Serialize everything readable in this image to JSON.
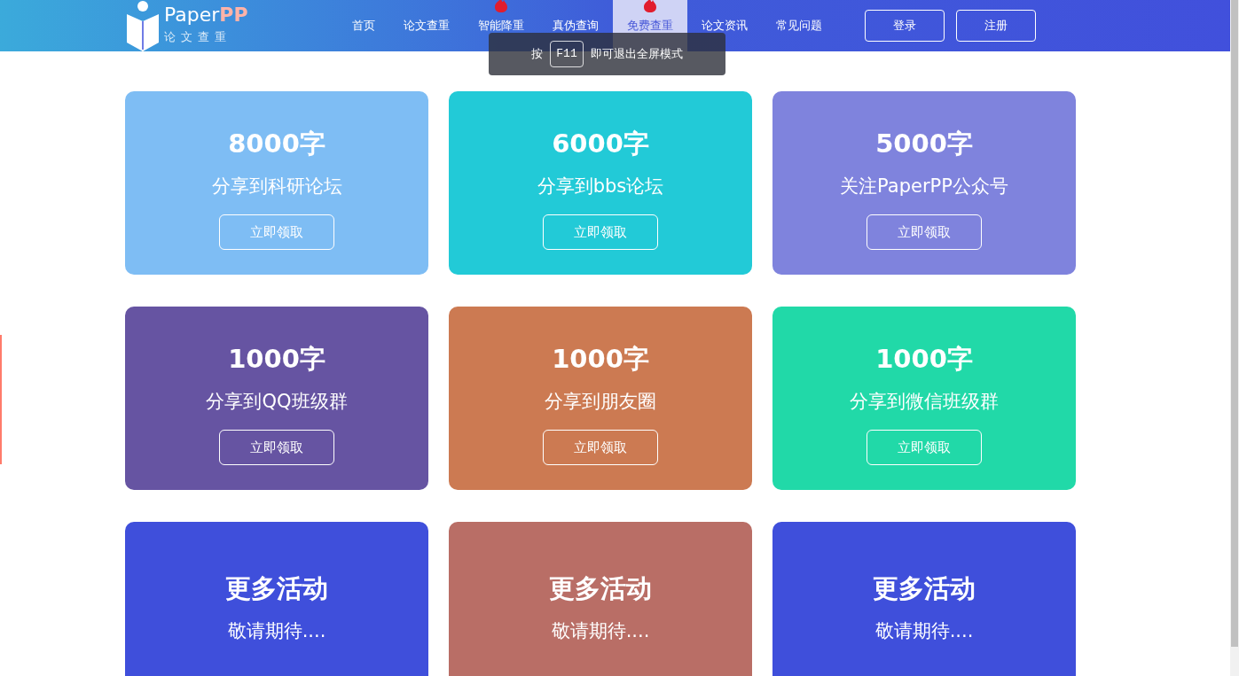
{
  "logo": {
    "name_part1": "Paper",
    "name_part2": "PP",
    "subtitle": "论文查重"
  },
  "nav": [
    {
      "label": "首页",
      "selected": false,
      "hot": false
    },
    {
      "label": "论文查重",
      "selected": false,
      "hot": false
    },
    {
      "label": "智能降重",
      "selected": false,
      "hot": true
    },
    {
      "label": "真伪查询",
      "selected": false,
      "hot": false
    },
    {
      "label": "免费查重",
      "selected": true,
      "hot": true
    },
    {
      "label": "论文资讯",
      "selected": false,
      "hot": false
    },
    {
      "label": "常见问题",
      "selected": false,
      "hot": false
    }
  ],
  "auth_buttons": [
    "登录",
    "注册"
  ],
  "toast": {
    "before": "按",
    "key": "F11",
    "after": "即可退出全屏模式"
  },
  "cards": [
    {
      "color": "#7ebdf4",
      "title": "8000字",
      "subtitle": "分享到科研论坛",
      "button": "立即领取"
    },
    {
      "color": "#22cad7",
      "title": "6000字",
      "subtitle": "分享到bbs论坛",
      "button": "立即领取"
    },
    {
      "color": "#7f83dd",
      "title": "5000字",
      "subtitle": "关注PaperPP公众号",
      "button": "立即领取"
    },
    {
      "color": "#6654a2",
      "title": "1000字",
      "subtitle": "分享到QQ班级群",
      "button": "立即领取"
    },
    {
      "color": "#cc7a52",
      "title": "1000字",
      "subtitle": "分享到朋友圈",
      "button": "立即领取"
    },
    {
      "color": "#21d9a8",
      "title": "1000字",
      "subtitle": "分享到微信班级群",
      "button": "立即领取"
    },
    {
      "color": "#3f4fdb",
      "title": "更多活动",
      "subtitle": "敬请期待...."
    },
    {
      "color": "#b96e66",
      "title": "更多活动",
      "subtitle": "敬请期待...."
    },
    {
      "color": "#3f4fdb",
      "title": "更多活动",
      "subtitle": "敬请期待...."
    }
  ]
}
